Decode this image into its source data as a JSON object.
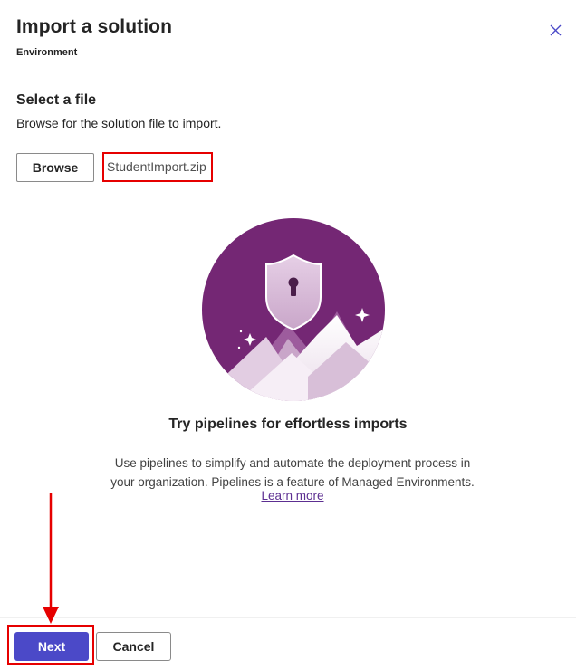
{
  "dialog": {
    "title": "Import a solution",
    "subtitle": "Environment",
    "close_icon": "close-icon"
  },
  "file_section": {
    "heading": "Select a file",
    "description": "Browse for the solution file to import.",
    "browse_label": "Browse",
    "selected_file": "StudentImport.zip"
  },
  "promo": {
    "illustration_icon": "shield-keyhole-mountains-illustration",
    "title": "Try pipelines for effortless imports",
    "line1": "Use pipelines to simplify and automate the deployment process in",
    "line2": "your organization. Pipelines is a feature of Managed Environments.",
    "link_label": "Learn more"
  },
  "footer": {
    "next_label": "Next",
    "cancel_label": "Cancel"
  },
  "colors": {
    "primary": "#4b49c8",
    "illustration_bg": "#742774",
    "link": "#5c2e91",
    "annotation_red": "#e60000"
  }
}
